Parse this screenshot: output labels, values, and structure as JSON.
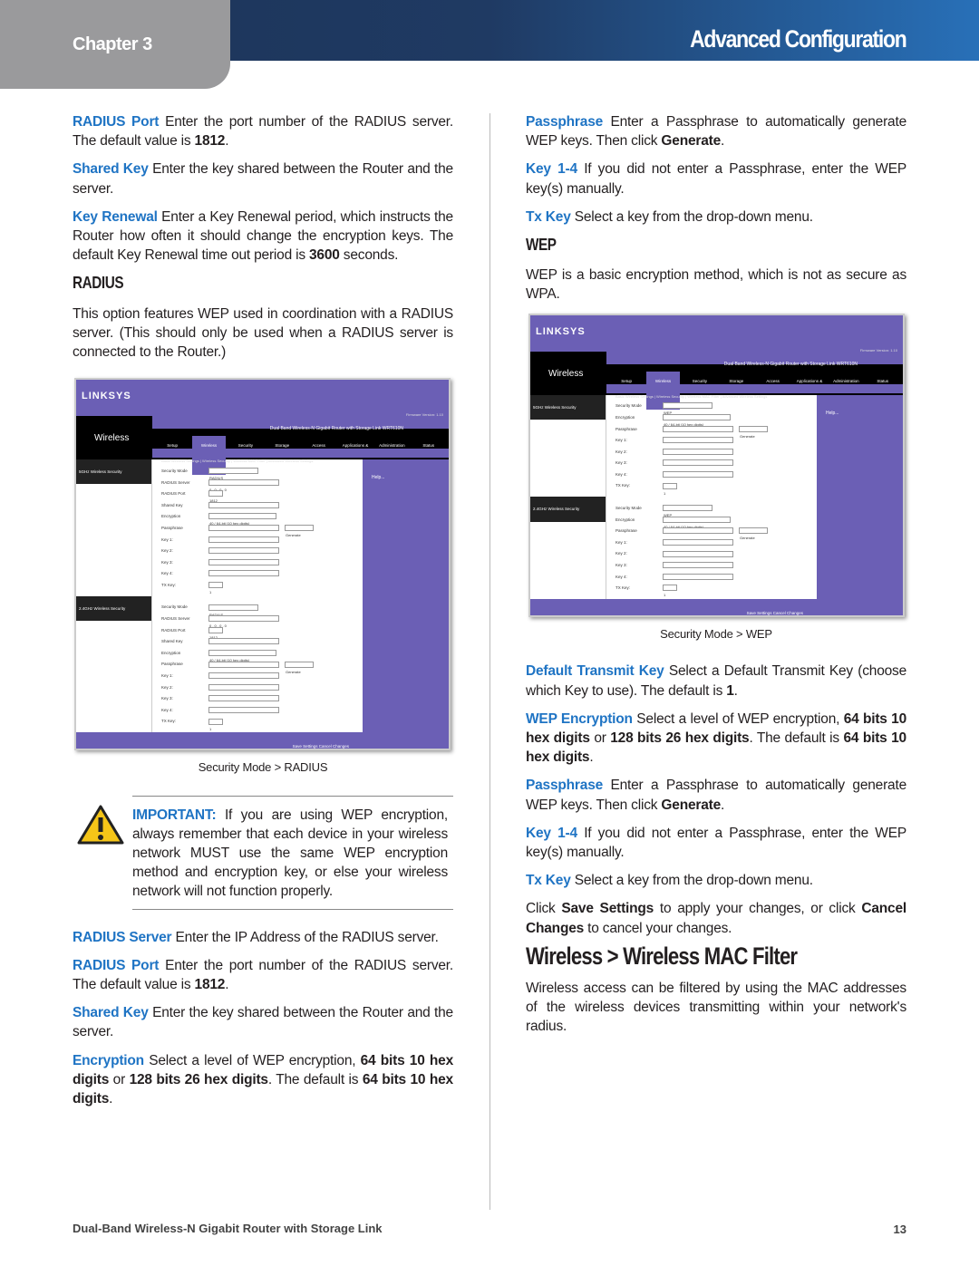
{
  "header": {
    "chapter": "Chapter 3",
    "title": "Advanced Configuration"
  },
  "left": [
    {
      "type": "p",
      "seg": [
        {
          "t": "RADIUS Port",
          "s": "term"
        },
        {
          "t": "  Enter the port number of the RADIUS server. The default value is "
        },
        {
          "t": "1812",
          "s": "b"
        },
        {
          "t": "."
        }
      ]
    },
    {
      "type": "p",
      "seg": [
        {
          "t": "Shared Key",
          "s": "term"
        },
        {
          "t": "  Enter the key shared between the Router and the server."
        }
      ]
    },
    {
      "type": "p",
      "seg": [
        {
          "t": "Key Renewal",
          "s": "term"
        },
        {
          "t": "  Enter a Key Renewal period, which instructs the Router how often it should change the encryption keys. The default Key Renewal time out period is "
        },
        {
          "t": "3600",
          "s": "b"
        },
        {
          "t": " seconds."
        }
      ]
    },
    {
      "type": "h3",
      "text": "RADIUS"
    },
    {
      "type": "p",
      "seg": [
        {
          "t": "This option features WEP used in coordination with a RADIUS server. (This should only be used when a RADIUS server is connected to the Router.)"
        }
      ]
    },
    {
      "type": "shot",
      "mode": "radius"
    },
    {
      "type": "caption",
      "text": "Security Mode > RADIUS"
    },
    {
      "type": "important",
      "seg": [
        {
          "t": "IMPORTANT:",
          "s": "term"
        },
        {
          "t": " If you are using WEP encryption, always remember that each device in your wireless network MUST use the same WEP encryption method and encryption key, or else your wireless network will not function properly."
        }
      ]
    },
    {
      "type": "p",
      "seg": [
        {
          "t": "RADIUS Server",
          "s": "term"
        },
        {
          "t": "  Enter the IP Address of the RADIUS server."
        }
      ]
    },
    {
      "type": "p",
      "seg": [
        {
          "t": "RADIUS Port",
          "s": "term"
        },
        {
          "t": "  Enter the port number of the RADIUS server. The default value is "
        },
        {
          "t": "1812",
          "s": "b"
        },
        {
          "t": "."
        }
      ]
    },
    {
      "type": "p",
      "seg": [
        {
          "t": "Shared Key",
          "s": "term"
        },
        {
          "t": "  Enter the key shared between the Router and the server."
        }
      ]
    },
    {
      "type": "p",
      "seg": [
        {
          "t": "Encryption",
          "s": "term"
        },
        {
          "t": "  Select a level of WEP encryption, "
        },
        {
          "t": "64 bits 10 hex digits",
          "s": "b"
        },
        {
          "t": " or "
        },
        {
          "t": "128 bits 26 hex digits",
          "s": "b"
        },
        {
          "t": ". The default is "
        },
        {
          "t": "64 bits 10 hex digits",
          "s": "b"
        },
        {
          "t": "."
        }
      ]
    }
  ],
  "right": [
    {
      "type": "p",
      "seg": [
        {
          "t": "Passphrase",
          "s": "term"
        },
        {
          "t": "  Enter a Passphrase to automatically generate WEP keys. Then click "
        },
        {
          "t": "Generate",
          "s": "b"
        },
        {
          "t": "."
        }
      ]
    },
    {
      "type": "p",
      "seg": [
        {
          "t": "Key 1-4",
          "s": "term"
        },
        {
          "t": "  If you did not enter a Passphrase, enter the WEP key(s) manually."
        }
      ]
    },
    {
      "type": "p",
      "seg": [
        {
          "t": "Tx Key",
          "s": "term"
        },
        {
          "t": "  Select a key from the drop-down menu."
        }
      ]
    },
    {
      "type": "h3",
      "text": "WEP"
    },
    {
      "type": "p",
      "seg": [
        {
          "t": "WEP is a basic encryption method, which is not as secure as WPA."
        }
      ]
    },
    {
      "type": "shot",
      "mode": "wep"
    },
    {
      "type": "caption",
      "text": "Security Mode > WEP"
    },
    {
      "type": "p",
      "seg": [
        {
          "t": "Default Transmit Key",
          "s": "term"
        },
        {
          "t": "  Select a Default Transmit Key (choose which Key to use). The default is "
        },
        {
          "t": "1",
          "s": "b"
        },
        {
          "t": "."
        }
      ]
    },
    {
      "type": "p",
      "seg": [
        {
          "t": "WEP Encryption",
          "s": "term"
        },
        {
          "t": "  Select a level of WEP encryption, "
        },
        {
          "t": "64 bits 10 hex digits",
          "s": "b"
        },
        {
          "t": " or "
        },
        {
          "t": "128 bits 26 hex digits",
          "s": "b"
        },
        {
          "t": ". The default is "
        },
        {
          "t": "64 bits 10 hex digits",
          "s": "b"
        },
        {
          "t": "."
        }
      ]
    },
    {
      "type": "p",
      "seg": [
        {
          "t": "Passphrase",
          "s": "term"
        },
        {
          "t": "  Enter a Passphrase to automatically generate WEP keys. Then click "
        },
        {
          "t": "Generate",
          "s": "b"
        },
        {
          "t": "."
        }
      ]
    },
    {
      "type": "p",
      "seg": [
        {
          "t": "Key 1-4",
          "s": "term"
        },
        {
          "t": "  If you did not enter a Passphrase, enter the WEP key(s) manually."
        }
      ]
    },
    {
      "type": "p",
      "seg": [
        {
          "t": "Tx Key",
          "s": "term"
        },
        {
          "t": "  Select a key from the drop-down menu."
        }
      ]
    },
    {
      "type": "p",
      "seg": [
        {
          "t": "Click "
        },
        {
          "t": "Save Settings",
          "s": "b"
        },
        {
          "t": " to apply your changes, or click "
        },
        {
          "t": "Cancel Changes",
          "s": "b"
        },
        {
          "t": " to cancel your changes."
        }
      ]
    },
    {
      "type": "h2",
      "text": "Wireless > Wireless MAC Filter"
    },
    {
      "type": "p",
      "seg": [
        {
          "t": "Wireless access can be filtered by using the MAC addresses of the wireless devices transmitting within your network's radius."
        }
      ]
    }
  ],
  "screenshot": {
    "logo": "LINKSYS",
    "firmware": "Firmware Version: 1.10",
    "section": "Wireless",
    "product": "Dual Band Wireless-N Gigabit Router with Storage Link",
    "model": "WRT610N",
    "tabs": [
      "Setup",
      "Wireless",
      "Security",
      "Storage",
      "Access Restrictions",
      "Applications & Gaming",
      "Administration",
      "Status"
    ],
    "subtabs": "Basic Wireless Settings | Wireless Security | Wireless MAC Filter | Advanced Wireless Settings",
    "sec5": "5GHz Wireless Security",
    "sec24": "2.4GHz Wireless Security",
    "help": "Help...",
    "save": "Save Settings",
    "cancel": "Cancel Changes",
    "generate": "Generate",
    "radius_fields": [
      [
        "Security Mode",
        "RADIUS"
      ],
      [
        "RADIUS Server",
        "0 . 0 . 0 . 0"
      ],
      [
        "RADIUS Port",
        "1812"
      ],
      [
        "Shared Key",
        ""
      ],
      [
        "Encryption",
        "40 / 64-bit (10 hex digits)"
      ],
      [
        "Passphrase",
        ""
      ],
      [
        "Key 1:",
        ""
      ],
      [
        "Key 2:",
        ""
      ],
      [
        "Key 3:",
        ""
      ],
      [
        "Key 4:",
        ""
      ],
      [
        "TX Key:",
        "1"
      ]
    ],
    "wep_fields": [
      [
        "Security Mode",
        "WEP"
      ],
      [
        "Encryption",
        "40 / 64-bit (10 hex digits)"
      ],
      [
        "Passphrase",
        ""
      ],
      [
        "Key 1:",
        ""
      ],
      [
        "Key 2:",
        ""
      ],
      [
        "Key 3:",
        ""
      ],
      [
        "Key 4:",
        ""
      ],
      [
        "TX Key:",
        "1"
      ]
    ]
  },
  "footer": {
    "product": "Dual-Band Wireless-N Gigabit Router with Storage Link",
    "page": "13"
  }
}
